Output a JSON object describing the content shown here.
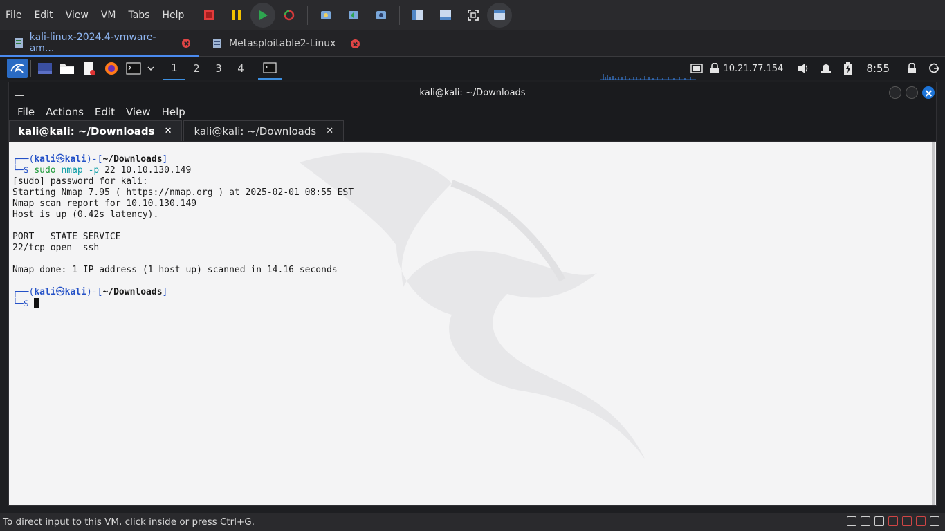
{
  "vm_menu": [
    "File",
    "Edit",
    "View",
    "VM",
    "Tabs",
    "Help"
  ],
  "vm_tabs": [
    {
      "label": "kali-linux-2024.4-vmware-am...",
      "active": true
    },
    {
      "label": "Metasploitable2-Linux",
      "active": false
    }
  ],
  "panel": {
    "workspaces": [
      "1",
      "2",
      "3",
      "4"
    ],
    "active_workspace": "1",
    "ip": "10.21.77.154",
    "clock": "8:55"
  },
  "terminal": {
    "title": "kali@kali: ~/Downloads",
    "menu": [
      "File",
      "Actions",
      "Edit",
      "View",
      "Help"
    ],
    "tabs": [
      {
        "label": "kali@kali: ~/Downloads",
        "active": true
      },
      {
        "label": "kali@kali: ~/Downloads",
        "active": false
      }
    ],
    "prompt_user": "kali",
    "prompt_host": "kali",
    "prompt_path": "~/Downloads",
    "command_sudo": "sudo",
    "command_nmap": "nmap",
    "command_flag": "-p",
    "command_rest": "22 10.10.130.149",
    "output": [
      "[sudo] password for kali:",
      "Starting Nmap 7.95 ( https://nmap.org ) at 2025-02-01 08:55 EST",
      "Nmap scan report for 10.10.130.149",
      "Host is up (0.42s latency).",
      "",
      "PORT   STATE SERVICE",
      "22/tcp open  ssh",
      "",
      "Nmap done: 1 IP address (1 host up) scanned in 14.16 seconds"
    ]
  },
  "status": {
    "text": "To direct input to this VM, click inside or press Ctrl+G."
  },
  "colors": {
    "accent": "#4b8bf0",
    "prompt_blue": "#2451c7",
    "command_green": "#1f9a3a",
    "close_red": "#e04545"
  }
}
